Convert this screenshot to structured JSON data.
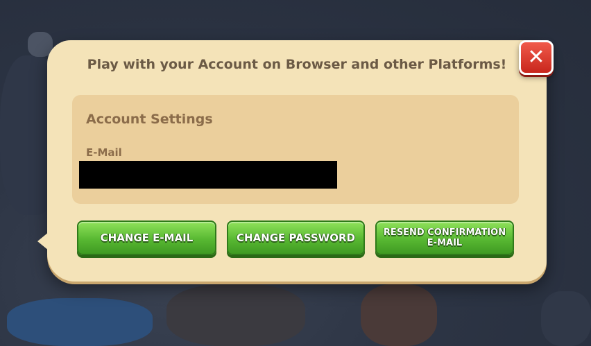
{
  "dialog": {
    "title": "Play with your Account on Browser and other Platforms!",
    "close_icon": "close-icon",
    "close_symbol": "✕"
  },
  "panel": {
    "title": "Account Settings",
    "email_label": "E-Mail",
    "email_value": ""
  },
  "buttons": {
    "change_email": "CHANGE E-MAIL",
    "change_password": "CHANGE PASSWORD",
    "resend_confirmation": "RESEND CONFIRMATION E-MAIL"
  },
  "colors": {
    "dialog_bg": "#f4e3b8",
    "panel_bg": "#ebcf9c",
    "button_green": "#58b832",
    "close_red": "#d8352a",
    "text_brown": "#6b5a45"
  }
}
